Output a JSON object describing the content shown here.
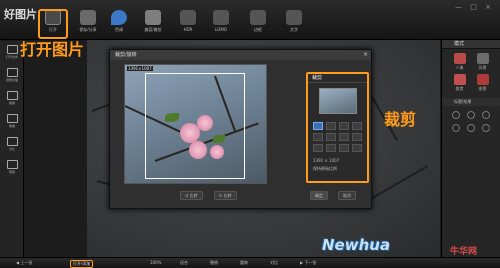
{
  "app": {
    "logo": "好图片",
    "window_buttons": "— □ ×"
  },
  "toolbar": {
    "items": [
      {
        "label": "打开"
      },
      {
        "label": "保存/分享"
      },
      {
        "label": "色调"
      },
      {
        "label": "美容/美妆"
      },
      {
        "label": "HDR"
      },
      {
        "label": "LOMO"
      },
      {
        "label": "边框"
      },
      {
        "label": "文字"
      }
    ]
  },
  "sidebar": {
    "items": [
      {
        "label": "打开文件"
      },
      {
        "label": "批量处理"
      },
      {
        "label": "撤销"
      },
      {
        "label": "重做"
      },
      {
        "label": "对比"
      },
      {
        "label": "帮助"
      }
    ]
  },
  "right_panel": {
    "header": "模式",
    "items": [
      {
        "label": "人像"
      },
      {
        "label": "风景"
      },
      {
        "label": "美食"
      },
      {
        "label": "夜景"
      }
    ],
    "subheader": "标题/效果"
  },
  "dialog": {
    "title": "裁剪/旋转",
    "close": "×",
    "preview_size": "1391×1007",
    "side_header": "裁剪",
    "width_height": "1391 × 1007",
    "keep_ratio": "保持原始比例",
    "buttons": {
      "rotate_left": "↺ 左转",
      "rotate_right": "↻ 右转",
      "ok": "确定",
      "cancel": "取消"
    }
  },
  "annotations": {
    "open": "打开图片",
    "crop": "裁剪"
  },
  "bottombar": {
    "items": [
      "◀ 上一张",
      "打开/添加",
      "100%",
      "适合",
      "撤销",
      "重做",
      "对比",
      "▶ 下一张"
    ]
  },
  "watermark": {
    "text": "Newhua",
    "cn": "牛华网"
  }
}
